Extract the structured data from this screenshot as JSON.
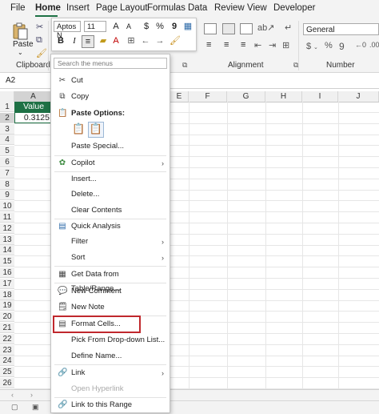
{
  "menubar": {
    "tabs": [
      "File",
      "Home",
      "Insert",
      "Page Layout",
      "Formulas",
      "Data",
      "Review",
      "View",
      "Developer"
    ]
  },
  "ribbon": {
    "paste_label": "Paste",
    "clipboard_label": "Clipboard",
    "alignment_label": "Alignment",
    "number_label": "Number",
    "number_format": "General",
    "mini_font": "Aptos N",
    "mini_size": "11"
  },
  "formula_bar": {
    "name_box": "A2"
  },
  "grid": {
    "columns": [
      "A",
      "E",
      "F",
      "G",
      "H",
      "I",
      "J"
    ],
    "rows": [
      "1",
      "2",
      "3",
      "4",
      "5",
      "6",
      "7",
      "8",
      "9",
      "10",
      "11",
      "12",
      "13",
      "14",
      "15",
      "16",
      "17",
      "18",
      "19",
      "20",
      "21",
      "22",
      "23",
      "24",
      "25",
      "26"
    ],
    "a1": "Value",
    "a2": "0.3125",
    "header_color": "#1e7145"
  },
  "context_menu": {
    "search_placeholder": "Search the menus",
    "paste_options_label": "Paste Options:",
    "items": {
      "cut": "Cut",
      "copy": "Copy",
      "paste_special": "Paste Special...",
      "copilot": "Copilot",
      "insert": "Insert...",
      "delete": "Delete...",
      "clear_contents": "Clear Contents",
      "quick_analysis": "Quick Analysis",
      "filter": "Filter",
      "sort": "Sort",
      "get_data": "Get Data from Table/Range...",
      "new_comment": "New Comment",
      "new_note": "New Note",
      "format_cells": "Format Cells...",
      "pick_dropdown": "Pick From Drop-down List...",
      "define_name": "Define Name...",
      "link": "Link",
      "open_hyperlink": "Open Hyperlink",
      "link_range": "Link to this Range"
    },
    "highlight_color": "#c0282d"
  }
}
